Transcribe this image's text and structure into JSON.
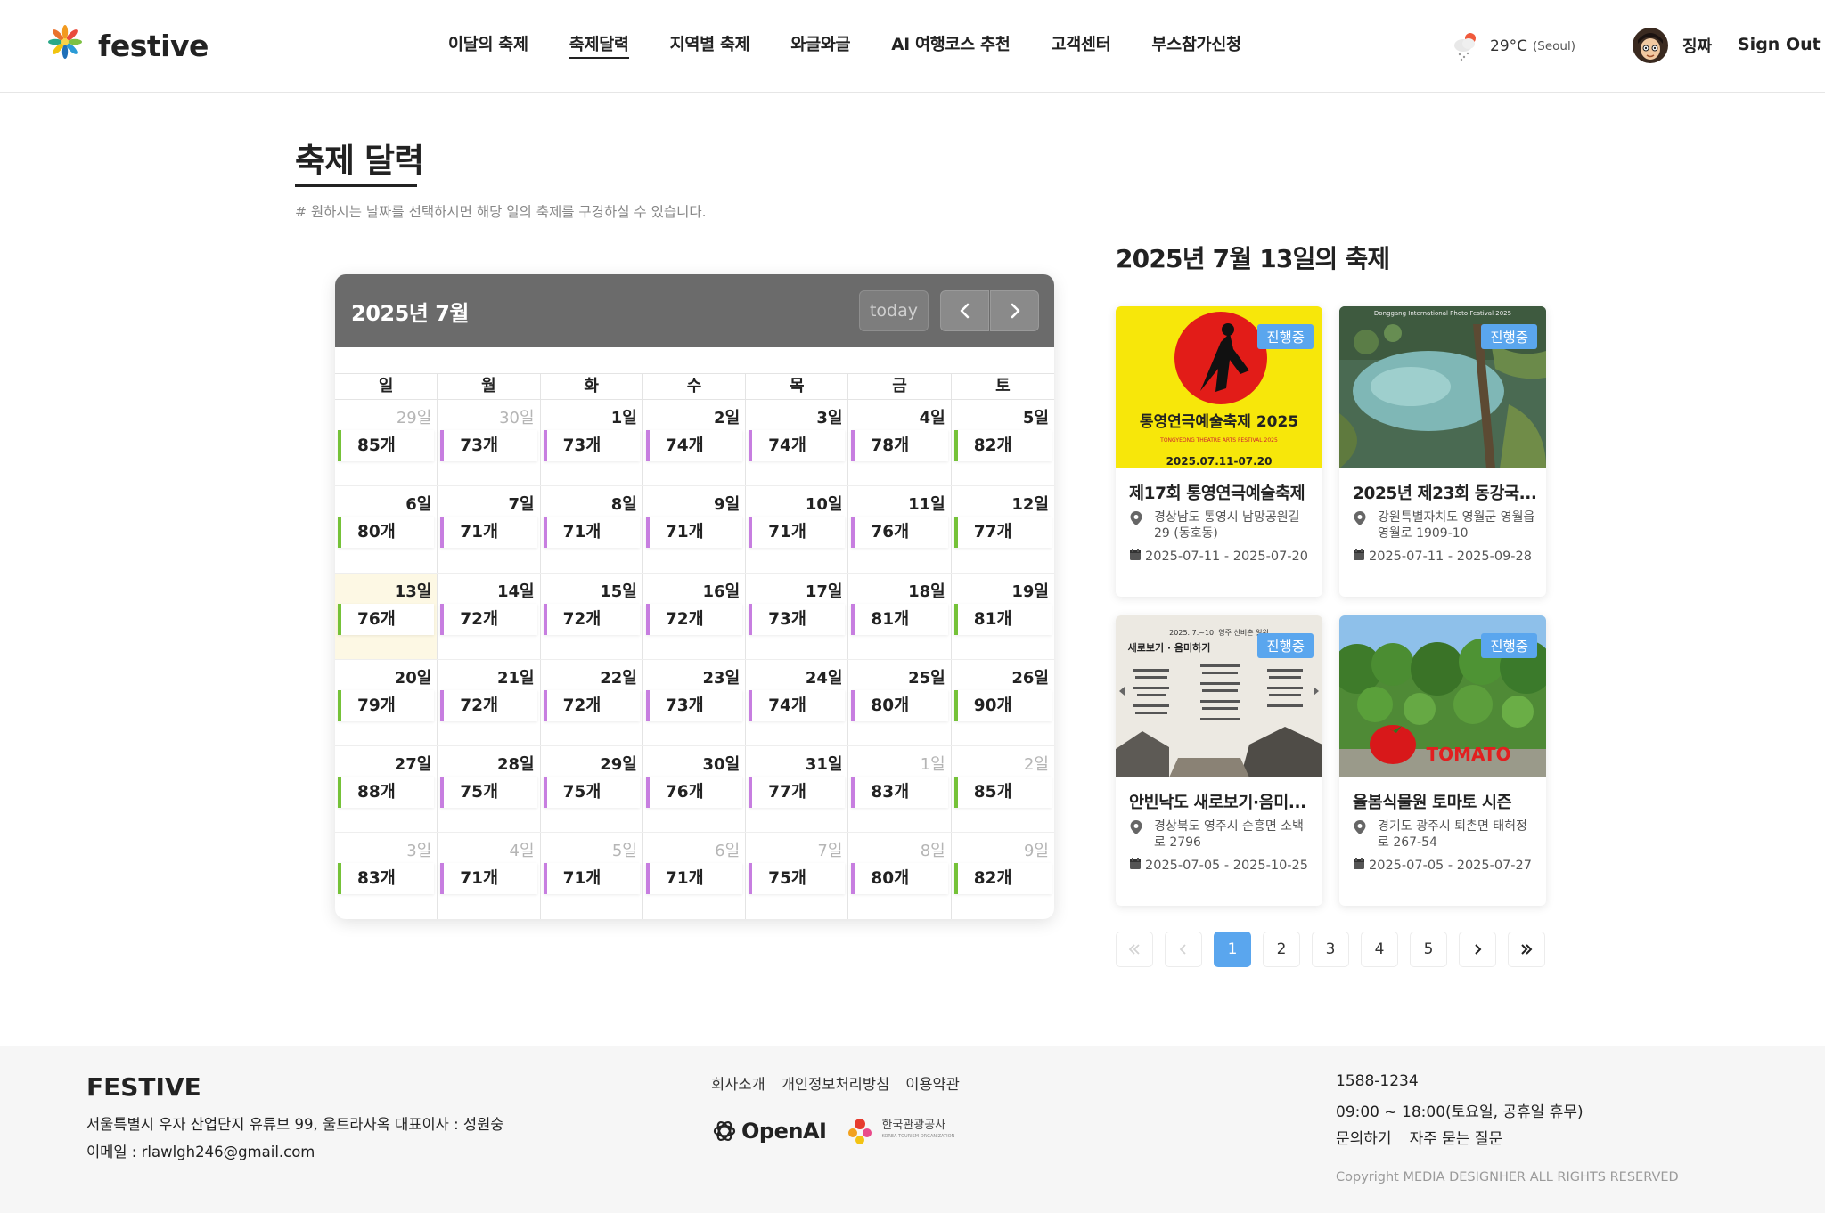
{
  "header": {
    "logo_text": "festive",
    "nav": [
      "이달의 축제",
      "축제달력",
      "지역별 축제",
      "와글와글",
      "AI 여행코스 추천",
      "고객센터",
      "부스참가신청"
    ],
    "active_nav": 1,
    "weather_temp": "29°C",
    "weather_city": "(Seoul)",
    "user_name": "징짜",
    "signout": "Sign Out"
  },
  "page": {
    "title": "축제 달력",
    "description": "# 원하시는 날짜를 선택하시면 해당 일의 축제를 구경하실 수 있습니다."
  },
  "calendar": {
    "title": "2025년 7월",
    "today_label": "today",
    "weekdays": [
      "일",
      "월",
      "화",
      "수",
      "목",
      "금",
      "토"
    ],
    "accent_weekday": "#c77ee0",
    "accent_weekend": "#75c238",
    "selected_bg": "#fdf8e4",
    "weeks": [
      [
        {
          "day": "29일",
          "count": "85개",
          "other": true
        },
        {
          "day": "30일",
          "count": "73개",
          "other": true
        },
        {
          "day": "1일",
          "count": "73개"
        },
        {
          "day": "2일",
          "count": "74개"
        },
        {
          "day": "3일",
          "count": "74개"
        },
        {
          "day": "4일",
          "count": "78개"
        },
        {
          "day": "5일",
          "count": "82개"
        }
      ],
      [
        {
          "day": "6일",
          "count": "80개"
        },
        {
          "day": "7일",
          "count": "71개"
        },
        {
          "day": "8일",
          "count": "71개"
        },
        {
          "day": "9일",
          "count": "71개"
        },
        {
          "day": "10일",
          "count": "71개"
        },
        {
          "day": "11일",
          "count": "76개"
        },
        {
          "day": "12일",
          "count": "77개"
        }
      ],
      [
        {
          "day": "13일",
          "count": "76개",
          "selected": true
        },
        {
          "day": "14일",
          "count": "72개"
        },
        {
          "day": "15일",
          "count": "72개"
        },
        {
          "day": "16일",
          "count": "72개"
        },
        {
          "day": "17일",
          "count": "73개"
        },
        {
          "day": "18일",
          "count": "81개"
        },
        {
          "day": "19일",
          "count": "81개"
        }
      ],
      [
        {
          "day": "20일",
          "count": "79개"
        },
        {
          "day": "21일",
          "count": "72개"
        },
        {
          "day": "22일",
          "count": "72개"
        },
        {
          "day": "23일",
          "count": "73개"
        },
        {
          "day": "24일",
          "count": "74개"
        },
        {
          "day": "25일",
          "count": "80개"
        },
        {
          "day": "26일",
          "count": "90개"
        }
      ],
      [
        {
          "day": "27일",
          "count": "88개"
        },
        {
          "day": "28일",
          "count": "75개"
        },
        {
          "day": "29일",
          "count": "75개"
        },
        {
          "day": "30일",
          "count": "76개"
        },
        {
          "day": "31일",
          "count": "77개"
        },
        {
          "day": "1일",
          "count": "83개",
          "other": true
        },
        {
          "day": "2일",
          "count": "85개",
          "other": true
        }
      ],
      [
        {
          "day": "3일",
          "count": "83개",
          "other": true
        },
        {
          "day": "4일",
          "count": "71개",
          "other": true
        },
        {
          "day": "5일",
          "count": "71개",
          "other": true
        },
        {
          "day": "6일",
          "count": "71개",
          "other": true
        },
        {
          "day": "7일",
          "count": "75개",
          "other": true
        },
        {
          "day": "8일",
          "count": "80개",
          "other": true
        },
        {
          "day": "9일",
          "count": "82개",
          "other": true
        }
      ]
    ]
  },
  "festivals": {
    "heading": "2025년 7월 13일의 축제",
    "cards": [
      {
        "title": "제17회 통영연극예술축제",
        "badge": "진행중",
        "address": "경상남도 통영시 남망공원길 29 (동호동)",
        "date": "2025-07-11 - 2025-07-20",
        "thumb": "theatre",
        "poster_title": "통영연극예술축제 2025",
        "poster_sub": "TONGYEONG THEATRE ARTS FESTIVAL 2025",
        "poster_date": "2025.07.11-07.20"
      },
      {
        "title": "2025년 제23회 동강국...",
        "badge": "진행중",
        "address": "강원특별자치도 영월군 영월읍 영월로 1909-10",
        "date": "2025-07-11 - 2025-09-28",
        "thumb": "photo",
        "poster_title": "Donggang International Photo Festival 2025"
      },
      {
        "title": "안빈낙도 새로보기·음미...",
        "badge": "진행중",
        "address": "경상북도 영주시 순흥면 소백로 2796",
        "date": "2025-07-05 - 2025-10-25",
        "thumb": "heritage",
        "poster_title": "새로보기 · 음미하기",
        "poster_sub": "2025. 7.~10. 영주 선비촌 일원"
      },
      {
        "title": "율봄식물원 토마토 시즌",
        "badge": "진행중",
        "address": "경기도 광주시 퇴촌면 태허정로 267-54",
        "date": "2025-07-05 - 2025-07-27",
        "thumb": "tomato",
        "poster_title": "TOMATO"
      }
    ]
  },
  "pagination": {
    "pages": [
      "1",
      "2",
      "3",
      "4",
      "5"
    ],
    "active": "1"
  },
  "footer": {
    "brand": "FESTIVE",
    "address": "서울특별시 우자 산업단지 유튜브 99, 울트라사옥 대표이사 : 성원숭",
    "email": "이메일 : rlawlgh246@gmail.com",
    "links": [
      "회사소개",
      "개인정보처리방침",
      "이용약관"
    ],
    "partner_openai": "OpenAI",
    "partner_kto": "한국관광공사",
    "partner_kto_en": "KOREA TOURISM ORGANIZATION",
    "phone": "1588-1234",
    "hours": "09:00 ~ 18:00(토요일, 공휴일 휴무)",
    "help_links": [
      "문의하기",
      "자주 묻는 질문"
    ],
    "copyright": "Copyright MEDIA DESIGNHER ALL RIGHTS RESERVED"
  }
}
